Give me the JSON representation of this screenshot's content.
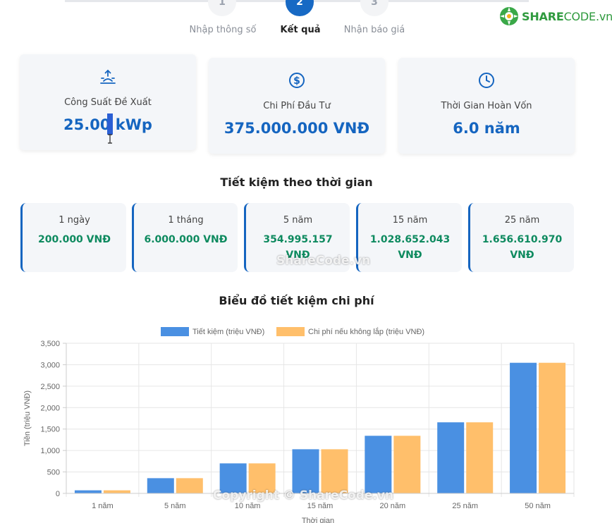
{
  "stepper": {
    "steps": [
      {
        "number": "1",
        "label": "Nhập thông số",
        "state": "inactive"
      },
      {
        "number": "2",
        "label": "Kết quả",
        "state": "active"
      },
      {
        "number": "3",
        "label": "Nhận báo giá",
        "state": "inactive"
      }
    ]
  },
  "logo": {
    "brand_bold": "SHARE",
    "brand_light": "CODE.vn"
  },
  "summary": {
    "power": {
      "label": "Công Suất Đề Xuất",
      "value": "25.00 kWp",
      "icon": "solar-panel-icon"
    },
    "cost": {
      "label": "Chi Phí Đầu Tư",
      "value": "375.000.000 VNĐ",
      "icon": "dollar-circle-icon"
    },
    "payback": {
      "label": "Thời Gian Hoàn Vốn",
      "value": "6.0 năm",
      "icon": "clock-icon"
    }
  },
  "savings_section": {
    "title": "Tiết kiệm theo thời gian",
    "items": [
      {
        "label": "1 ngày",
        "value": "200.000 VNĐ"
      },
      {
        "label": "1 tháng",
        "value": "6.000.000 VNĐ"
      },
      {
        "label": "5 năm",
        "value": "354.995.157 VNĐ"
      },
      {
        "label": "15 năm",
        "value": "1.028.652.043 VNĐ"
      },
      {
        "label": "25 năm",
        "value": "1.656.610.970 VNĐ"
      }
    ]
  },
  "chart_section": {
    "title": "Biểu đồ tiết kiệm chi phí"
  },
  "watermarks": {
    "center": "ShareCode.vn",
    "copyright": "Copyright © ShareCode.vn"
  },
  "colors": {
    "primary": "#1565c0",
    "savings_text": "#0e8a5f",
    "series1": "#4a90e2",
    "series2": "#ffbf6b"
  },
  "chart_data": {
    "type": "bar",
    "categories": [
      "1 năm",
      "5 năm",
      "10 năm",
      "15 năm",
      "20 năm",
      "25 năm",
      "50 năm"
    ],
    "series": [
      {
        "name": "Tiết kiệm (triệu VNĐ)",
        "values": [
          72,
          355,
          700,
          1029,
          1343,
          1657,
          3045
        ]
      },
      {
        "name": "Chi phí nếu không lắp (triệu VNĐ)",
        "values": [
          72,
          355,
          700,
          1029,
          1343,
          1657,
          3045
        ]
      }
    ],
    "yticks": [
      "0",
      "500",
      "1,000",
      "1,500",
      "2,000",
      "2,500",
      "3,000",
      "3,500"
    ],
    "ylim": [
      0,
      3500
    ],
    "xlabel": "Thời gian",
    "ylabel": "Tiền (triệu VNĐ)",
    "legend_position": "top",
    "grid": true
  }
}
